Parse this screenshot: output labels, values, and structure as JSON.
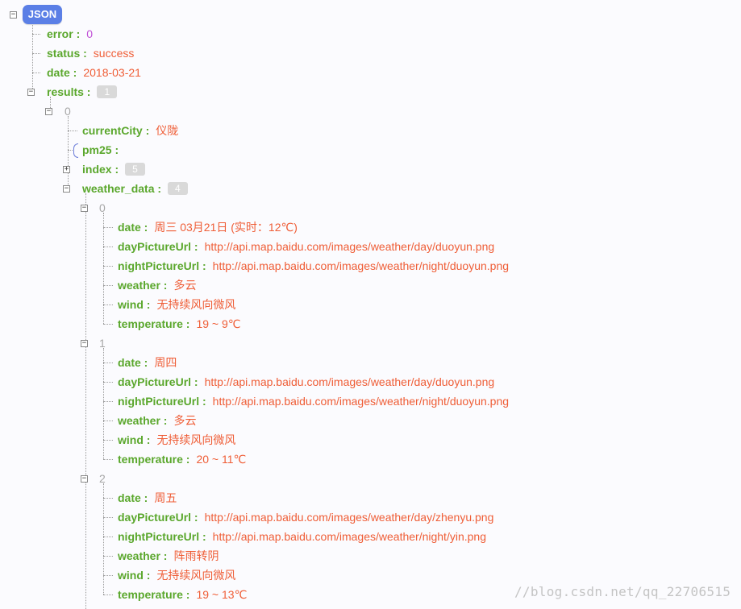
{
  "root": {
    "label": "JSON"
  },
  "fields": {
    "error": {
      "key": "error :",
      "value": "0"
    },
    "status": {
      "key": "status :",
      "value": "success"
    },
    "date": {
      "key": "date :",
      "value": "2018-03-21"
    },
    "results": {
      "key": "results :",
      "count": "1"
    }
  },
  "result0": {
    "index": "0",
    "currentCity": {
      "key": "currentCity :",
      "value": "仪陇"
    },
    "pm25": {
      "key": "pm25 :"
    },
    "index_field": {
      "key": "index :",
      "count": "5"
    },
    "weather_data": {
      "key": "weather_data :",
      "count": "4"
    }
  },
  "weather": [
    {
      "index": "0",
      "date": {
        "key": "date :",
        "value": "周三 03月21日 (实时：12℃)"
      },
      "dayPictureUrl": {
        "key": "dayPictureUrl :",
        "value": "http://api.map.baidu.com/images/weather/day/duoyun.png"
      },
      "nightPictureUrl": {
        "key": "nightPictureUrl :",
        "value": "http://api.map.baidu.com/images/weather/night/duoyun.png"
      },
      "weather": {
        "key": "weather :",
        "value": "多云"
      },
      "wind": {
        "key": "wind :",
        "value": "无持续风向微风"
      },
      "temperature": {
        "key": "temperature :",
        "value": "19 ~ 9℃"
      }
    },
    {
      "index": "1",
      "date": {
        "key": "date :",
        "value": "周四"
      },
      "dayPictureUrl": {
        "key": "dayPictureUrl :",
        "value": "http://api.map.baidu.com/images/weather/day/duoyun.png"
      },
      "nightPictureUrl": {
        "key": "nightPictureUrl :",
        "value": "http://api.map.baidu.com/images/weather/night/duoyun.png"
      },
      "weather": {
        "key": "weather :",
        "value": "多云"
      },
      "wind": {
        "key": "wind :",
        "value": "无持续风向微风"
      },
      "temperature": {
        "key": "temperature :",
        "value": "20 ~ 11℃"
      }
    },
    {
      "index": "2",
      "date": {
        "key": "date :",
        "value": "周五"
      },
      "dayPictureUrl": {
        "key": "dayPictureUrl :",
        "value": "http://api.map.baidu.com/images/weather/day/zhenyu.png"
      },
      "nightPictureUrl": {
        "key": "nightPictureUrl :",
        "value": "http://api.map.baidu.com/images/weather/night/yin.png"
      },
      "weather": {
        "key": "weather :",
        "value": "阵雨转阴"
      },
      "wind": {
        "key": "wind :",
        "value": "无持续风向微风"
      },
      "temperature": {
        "key": "temperature :",
        "value": "19 ~ 13℃"
      }
    }
  ],
  "watermark": "//blog.csdn.net/qq_22706515"
}
